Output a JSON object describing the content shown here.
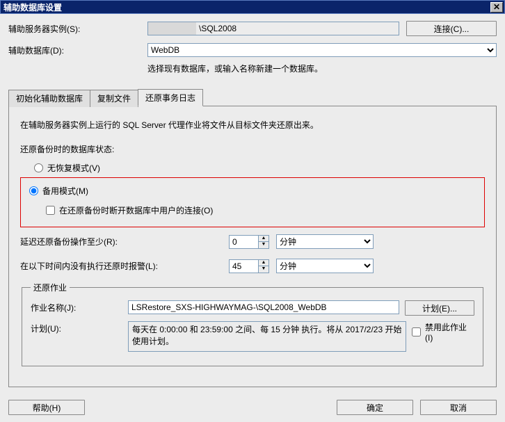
{
  "title": "辅助数据库设置",
  "server_label": "辅助服务器实例(S):",
  "server_value": "\\SQL2008",
  "connect_btn": "连接(C)...",
  "db_label": "辅助数据库(D):",
  "db_value": "WebDB",
  "db_hint": "选择现有数据库，或输入名称新建一个数据库。",
  "tabs": {
    "init": "初始化辅助数据库",
    "copy": "复制文件",
    "restore": "还原事务日志"
  },
  "panel": {
    "info": "在辅助服务器实例上运行的 SQL Server 代理作业将文件从目标文件夹还原出来。",
    "state_label": "还原备份时的数据库状态:",
    "radio_norecover": "无恢复模式(V)",
    "radio_standby": "备用模式(M)",
    "check_disconnect": "在还原备份时断开数据库中用户的连接(O)",
    "delay_label": "延迟还原备份操作至少(R):",
    "delay_value": "0",
    "delay_unit": "分钟",
    "alert_label": "在以下时间内没有执行还原时报警(L):",
    "alert_value": "45",
    "alert_unit": "分钟"
  },
  "job": {
    "legend": "还原作业",
    "name_label": "作业名称(J):",
    "name_value": "LSRestore_SXS-HIGHWAYMAG-\\SQL2008_WebDB",
    "plan_btn": "计划(E)...",
    "plan_label": "计划(U):",
    "plan_value": "每天在 0:00:00 和 23:59:00 之间、每 15 分钟 执行。将从 2017/2/23 开始使用计划。",
    "disable_label": "禁用此作业(I)"
  },
  "footer": {
    "help": "帮助(H)",
    "ok": "确定",
    "cancel": "取消"
  }
}
